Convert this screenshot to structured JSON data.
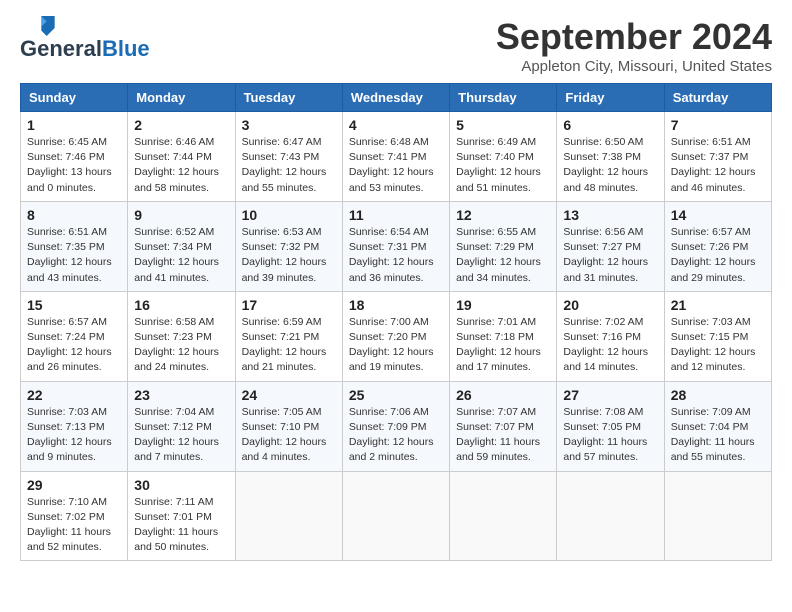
{
  "header": {
    "logo_general": "General",
    "logo_blue": "Blue",
    "month_title": "September 2024",
    "location": "Appleton City, Missouri, United States"
  },
  "days_of_week": [
    "Sunday",
    "Monday",
    "Tuesday",
    "Wednesday",
    "Thursday",
    "Friday",
    "Saturday"
  ],
  "weeks": [
    [
      {
        "day": "1",
        "info": "Sunrise: 6:45 AM\nSunset: 7:46 PM\nDaylight: 13 hours\nand 0 minutes."
      },
      {
        "day": "2",
        "info": "Sunrise: 6:46 AM\nSunset: 7:44 PM\nDaylight: 12 hours\nand 58 minutes."
      },
      {
        "day": "3",
        "info": "Sunrise: 6:47 AM\nSunset: 7:43 PM\nDaylight: 12 hours\nand 55 minutes."
      },
      {
        "day": "4",
        "info": "Sunrise: 6:48 AM\nSunset: 7:41 PM\nDaylight: 12 hours\nand 53 minutes."
      },
      {
        "day": "5",
        "info": "Sunrise: 6:49 AM\nSunset: 7:40 PM\nDaylight: 12 hours\nand 51 minutes."
      },
      {
        "day": "6",
        "info": "Sunrise: 6:50 AM\nSunset: 7:38 PM\nDaylight: 12 hours\nand 48 minutes."
      },
      {
        "day": "7",
        "info": "Sunrise: 6:51 AM\nSunset: 7:37 PM\nDaylight: 12 hours\nand 46 minutes."
      }
    ],
    [
      {
        "day": "8",
        "info": "Sunrise: 6:51 AM\nSunset: 7:35 PM\nDaylight: 12 hours\nand 43 minutes."
      },
      {
        "day": "9",
        "info": "Sunrise: 6:52 AM\nSunset: 7:34 PM\nDaylight: 12 hours\nand 41 minutes."
      },
      {
        "day": "10",
        "info": "Sunrise: 6:53 AM\nSunset: 7:32 PM\nDaylight: 12 hours\nand 39 minutes."
      },
      {
        "day": "11",
        "info": "Sunrise: 6:54 AM\nSunset: 7:31 PM\nDaylight: 12 hours\nand 36 minutes."
      },
      {
        "day": "12",
        "info": "Sunrise: 6:55 AM\nSunset: 7:29 PM\nDaylight: 12 hours\nand 34 minutes."
      },
      {
        "day": "13",
        "info": "Sunrise: 6:56 AM\nSunset: 7:27 PM\nDaylight: 12 hours\nand 31 minutes."
      },
      {
        "day": "14",
        "info": "Sunrise: 6:57 AM\nSunset: 7:26 PM\nDaylight: 12 hours\nand 29 minutes."
      }
    ],
    [
      {
        "day": "15",
        "info": "Sunrise: 6:57 AM\nSunset: 7:24 PM\nDaylight: 12 hours\nand 26 minutes."
      },
      {
        "day": "16",
        "info": "Sunrise: 6:58 AM\nSunset: 7:23 PM\nDaylight: 12 hours\nand 24 minutes."
      },
      {
        "day": "17",
        "info": "Sunrise: 6:59 AM\nSunset: 7:21 PM\nDaylight: 12 hours\nand 21 minutes."
      },
      {
        "day": "18",
        "info": "Sunrise: 7:00 AM\nSunset: 7:20 PM\nDaylight: 12 hours\nand 19 minutes."
      },
      {
        "day": "19",
        "info": "Sunrise: 7:01 AM\nSunset: 7:18 PM\nDaylight: 12 hours\nand 17 minutes."
      },
      {
        "day": "20",
        "info": "Sunrise: 7:02 AM\nSunset: 7:16 PM\nDaylight: 12 hours\nand 14 minutes."
      },
      {
        "day": "21",
        "info": "Sunrise: 7:03 AM\nSunset: 7:15 PM\nDaylight: 12 hours\nand 12 minutes."
      }
    ],
    [
      {
        "day": "22",
        "info": "Sunrise: 7:03 AM\nSunset: 7:13 PM\nDaylight: 12 hours\nand 9 minutes."
      },
      {
        "day": "23",
        "info": "Sunrise: 7:04 AM\nSunset: 7:12 PM\nDaylight: 12 hours\nand 7 minutes."
      },
      {
        "day": "24",
        "info": "Sunrise: 7:05 AM\nSunset: 7:10 PM\nDaylight: 12 hours\nand 4 minutes."
      },
      {
        "day": "25",
        "info": "Sunrise: 7:06 AM\nSunset: 7:09 PM\nDaylight: 12 hours\nand 2 minutes."
      },
      {
        "day": "26",
        "info": "Sunrise: 7:07 AM\nSunset: 7:07 PM\nDaylight: 11 hours\nand 59 minutes."
      },
      {
        "day": "27",
        "info": "Sunrise: 7:08 AM\nSunset: 7:05 PM\nDaylight: 11 hours\nand 57 minutes."
      },
      {
        "day": "28",
        "info": "Sunrise: 7:09 AM\nSunset: 7:04 PM\nDaylight: 11 hours\nand 55 minutes."
      }
    ],
    [
      {
        "day": "29",
        "info": "Sunrise: 7:10 AM\nSunset: 7:02 PM\nDaylight: 11 hours\nand 52 minutes."
      },
      {
        "day": "30",
        "info": "Sunrise: 7:11 AM\nSunset: 7:01 PM\nDaylight: 11 hours\nand 50 minutes."
      },
      {
        "day": "",
        "info": ""
      },
      {
        "day": "",
        "info": ""
      },
      {
        "day": "",
        "info": ""
      },
      {
        "day": "",
        "info": ""
      },
      {
        "day": "",
        "info": ""
      }
    ]
  ]
}
